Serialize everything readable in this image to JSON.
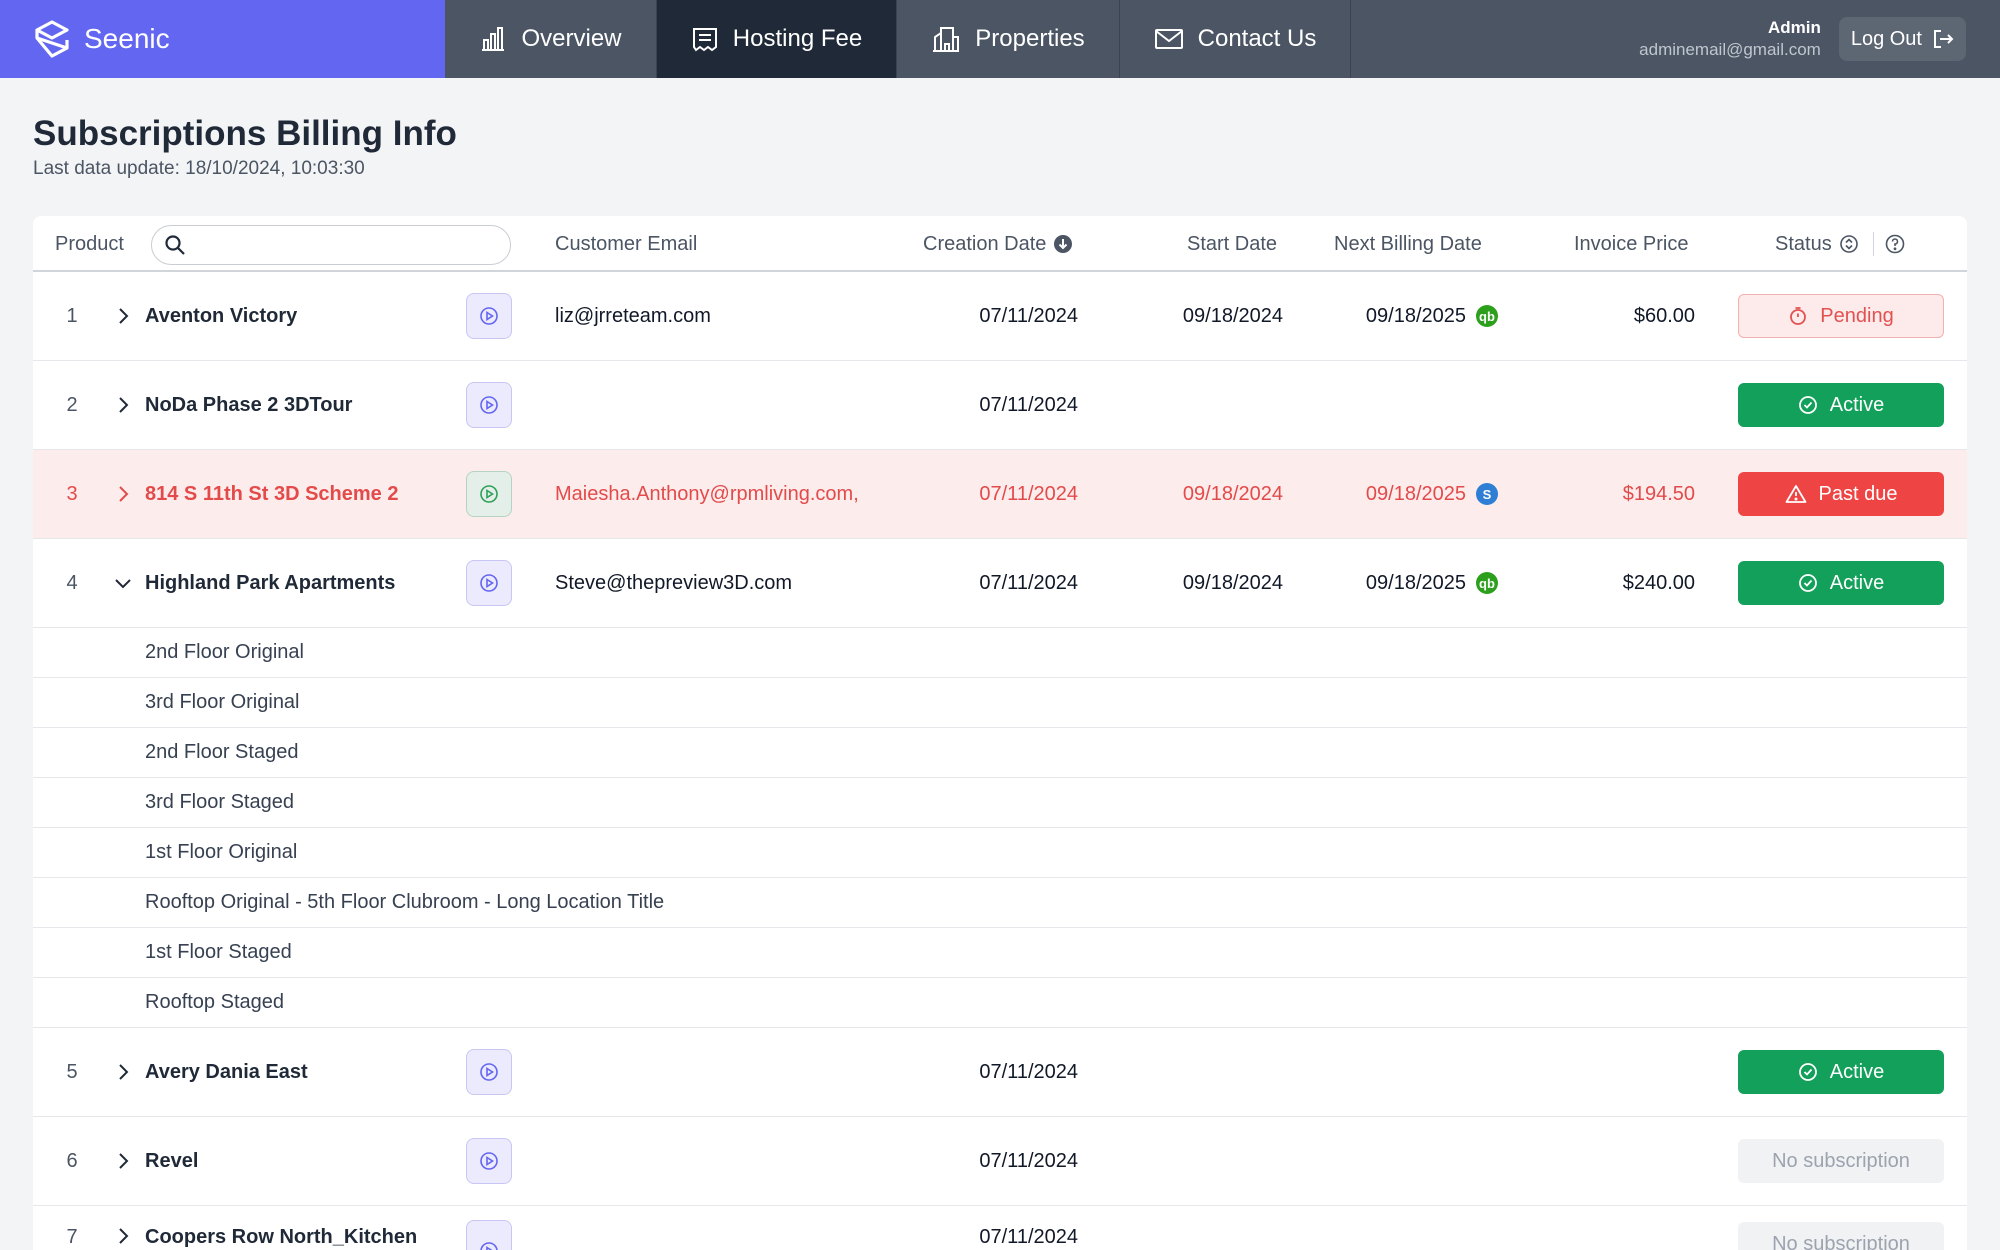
{
  "header": {
    "brand": "Seenic",
    "nav": [
      {
        "label": "Overview",
        "icon": "bar-chart-icon",
        "active": false
      },
      {
        "label": "Hosting Fee",
        "icon": "receipt-icon",
        "active": true
      },
      {
        "label": "Properties",
        "icon": "building-icon",
        "active": false
      },
      {
        "label": "Contact Us",
        "icon": "mail-icon",
        "active": false
      }
    ],
    "user_name": "Admin",
    "user_email": "adminemail@gmail.com",
    "logout_label": "Log Out"
  },
  "page": {
    "title": "Subscriptions Billing Info",
    "subtitle": "Last data update: 18/10/2024, 10:03:30"
  },
  "table": {
    "columns": {
      "product": "Product",
      "search_placeholder": "",
      "email": "Customer Email",
      "creation_date": "Creation Date",
      "start_date": "Start Date",
      "next_billing": "Next Billing Date",
      "invoice_price": "Invoice Price",
      "status": "Status"
    },
    "rows": [
      {
        "index": "1",
        "product": "Aventon Victory",
        "email": "liz@jrreteam.com",
        "creation_date": "07/11/2024",
        "start_date": "09/18/2024",
        "next_billing": "09/18/2025",
        "billing_source": "quickbooks",
        "price": "$60.00",
        "status": "Pending",
        "status_type": "pending"
      },
      {
        "index": "2",
        "product": "NoDa Phase 2 3DTour",
        "email": "",
        "creation_date": "07/11/2024",
        "start_date": "",
        "next_billing": "",
        "billing_source": "",
        "price": "",
        "status": "Active",
        "status_type": "active"
      },
      {
        "index": "3",
        "product": "814 S 11th St 3D Scheme 2",
        "email": "Maiesha.Anthony@rpmliving.com,",
        "creation_date": "07/11/2024",
        "start_date": "09/18/2024",
        "next_billing": "09/18/2025",
        "billing_source": "stripe",
        "price": "$194.50",
        "status": "Past due",
        "status_type": "pastdue"
      },
      {
        "index": "4",
        "product": "Highland Park Apartments",
        "email": "Steve@thepreview3D.com",
        "creation_date": "07/11/2024",
        "start_date": "09/18/2024",
        "next_billing": "09/18/2025",
        "billing_source": "quickbooks",
        "price": "$240.00",
        "status": "Active",
        "status_type": "active",
        "expanded": true,
        "locations": [
          "2nd Floor Original",
          "3rd Floor Original",
          "2nd Floor Staged",
          "3rd Floor Staged",
          "1st Floor Original",
          "Rooftop Original - 5th Floor Clubroom - Long Location Title",
          "1st Floor Staged",
          "Rooftop Staged"
        ]
      },
      {
        "index": "5",
        "product": "Avery Dania East",
        "email": "",
        "creation_date": "07/11/2024",
        "start_date": "",
        "next_billing": "",
        "billing_source": "",
        "price": "",
        "status": "Active",
        "status_type": "active"
      },
      {
        "index": "6",
        "product": "Revel",
        "email": "",
        "creation_date": "07/11/2024",
        "start_date": "",
        "next_billing": "",
        "billing_source": "",
        "price": "",
        "status": "No subscription",
        "status_type": "none"
      },
      {
        "index": "7",
        "product": "Coopers Row North_Kitchen",
        "email": "",
        "creation_date": "07/11/2024",
        "start_date": "",
        "next_billing": "",
        "billing_source": "",
        "price": "",
        "status": "No subscription",
        "status_type": "none"
      }
    ]
  },
  "colors": {
    "accent": "#6366f1",
    "active": "#13a05a",
    "pastdue": "#ef4444",
    "pending": "#e25151",
    "quickbooks": "#2ca01c",
    "stripe": "#2d7ed4"
  }
}
